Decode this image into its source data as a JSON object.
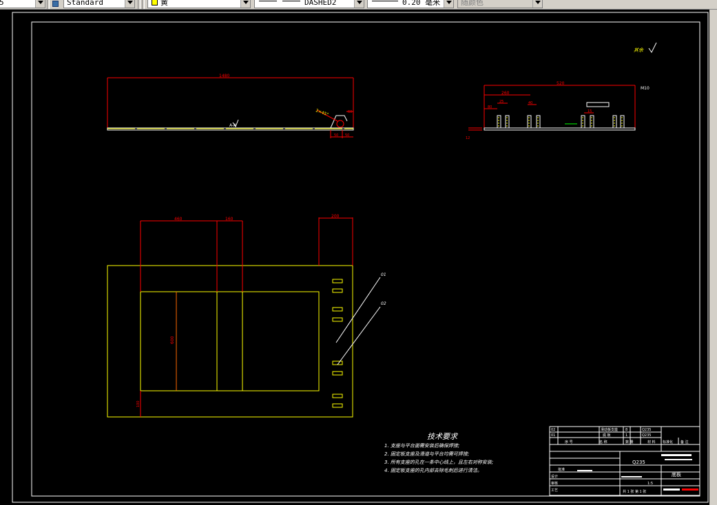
{
  "toolbar": {
    "layer_suffix": "5",
    "text_style": "Standard",
    "color": "黄",
    "color_swatch": "#ffff00",
    "linetype": "DASHED2",
    "lineweight": "0.20 毫米",
    "plot_style": "随颜色"
  },
  "drawing": {
    "front_view": {
      "length_dim": "1480",
      "chamfer_note": "2×45°",
      "dim_small_a": "60",
      "dim_small_b": "50",
      "section_mark": "A-A"
    },
    "side_view": {
      "total_dim": "520",
      "dim_260": "260",
      "dim_80": "80",
      "dim_25": "25",
      "dim_40": "40",
      "dim_15": "15",
      "height_dim": "12",
      "note": "M10"
    },
    "top_view": {
      "dim_460": "460",
      "dim_160": "160",
      "dim_200": "200",
      "dim_600": "600",
      "dim_100": "100",
      "leader_01": "01",
      "leader_02": "02"
    },
    "surface_symbol": "其余"
  },
  "tech_requirements": {
    "title": "技术要求",
    "items": [
      "1. 支座与平台面需安装后确保焊接;",
      "2. 固定板支座及滑道与平台均需可焊接;",
      "3. 所有支座的孔在一条中心线上，且左右对称安装;",
      "4. 固定板支座的孔内部去除毛刺后进行清洁。"
    ]
  },
  "title_block": {
    "row1": [
      "02",
      "滑动板支座",
      "8",
      "Q235"
    ],
    "row2": [
      "01",
      "底 板",
      "1",
      "Q235"
    ],
    "header": [
      "序 号",
      "名 称",
      "数 量",
      "材 料",
      "备 注"
    ],
    "material": "Q235",
    "part_name": "底板",
    "qty_label": "1:5",
    "sheet_label": "共 1 张  第 1 张",
    "small_labels": [
      "设计",
      "审核",
      "工艺",
      "标准化",
      "批准"
    ]
  }
}
